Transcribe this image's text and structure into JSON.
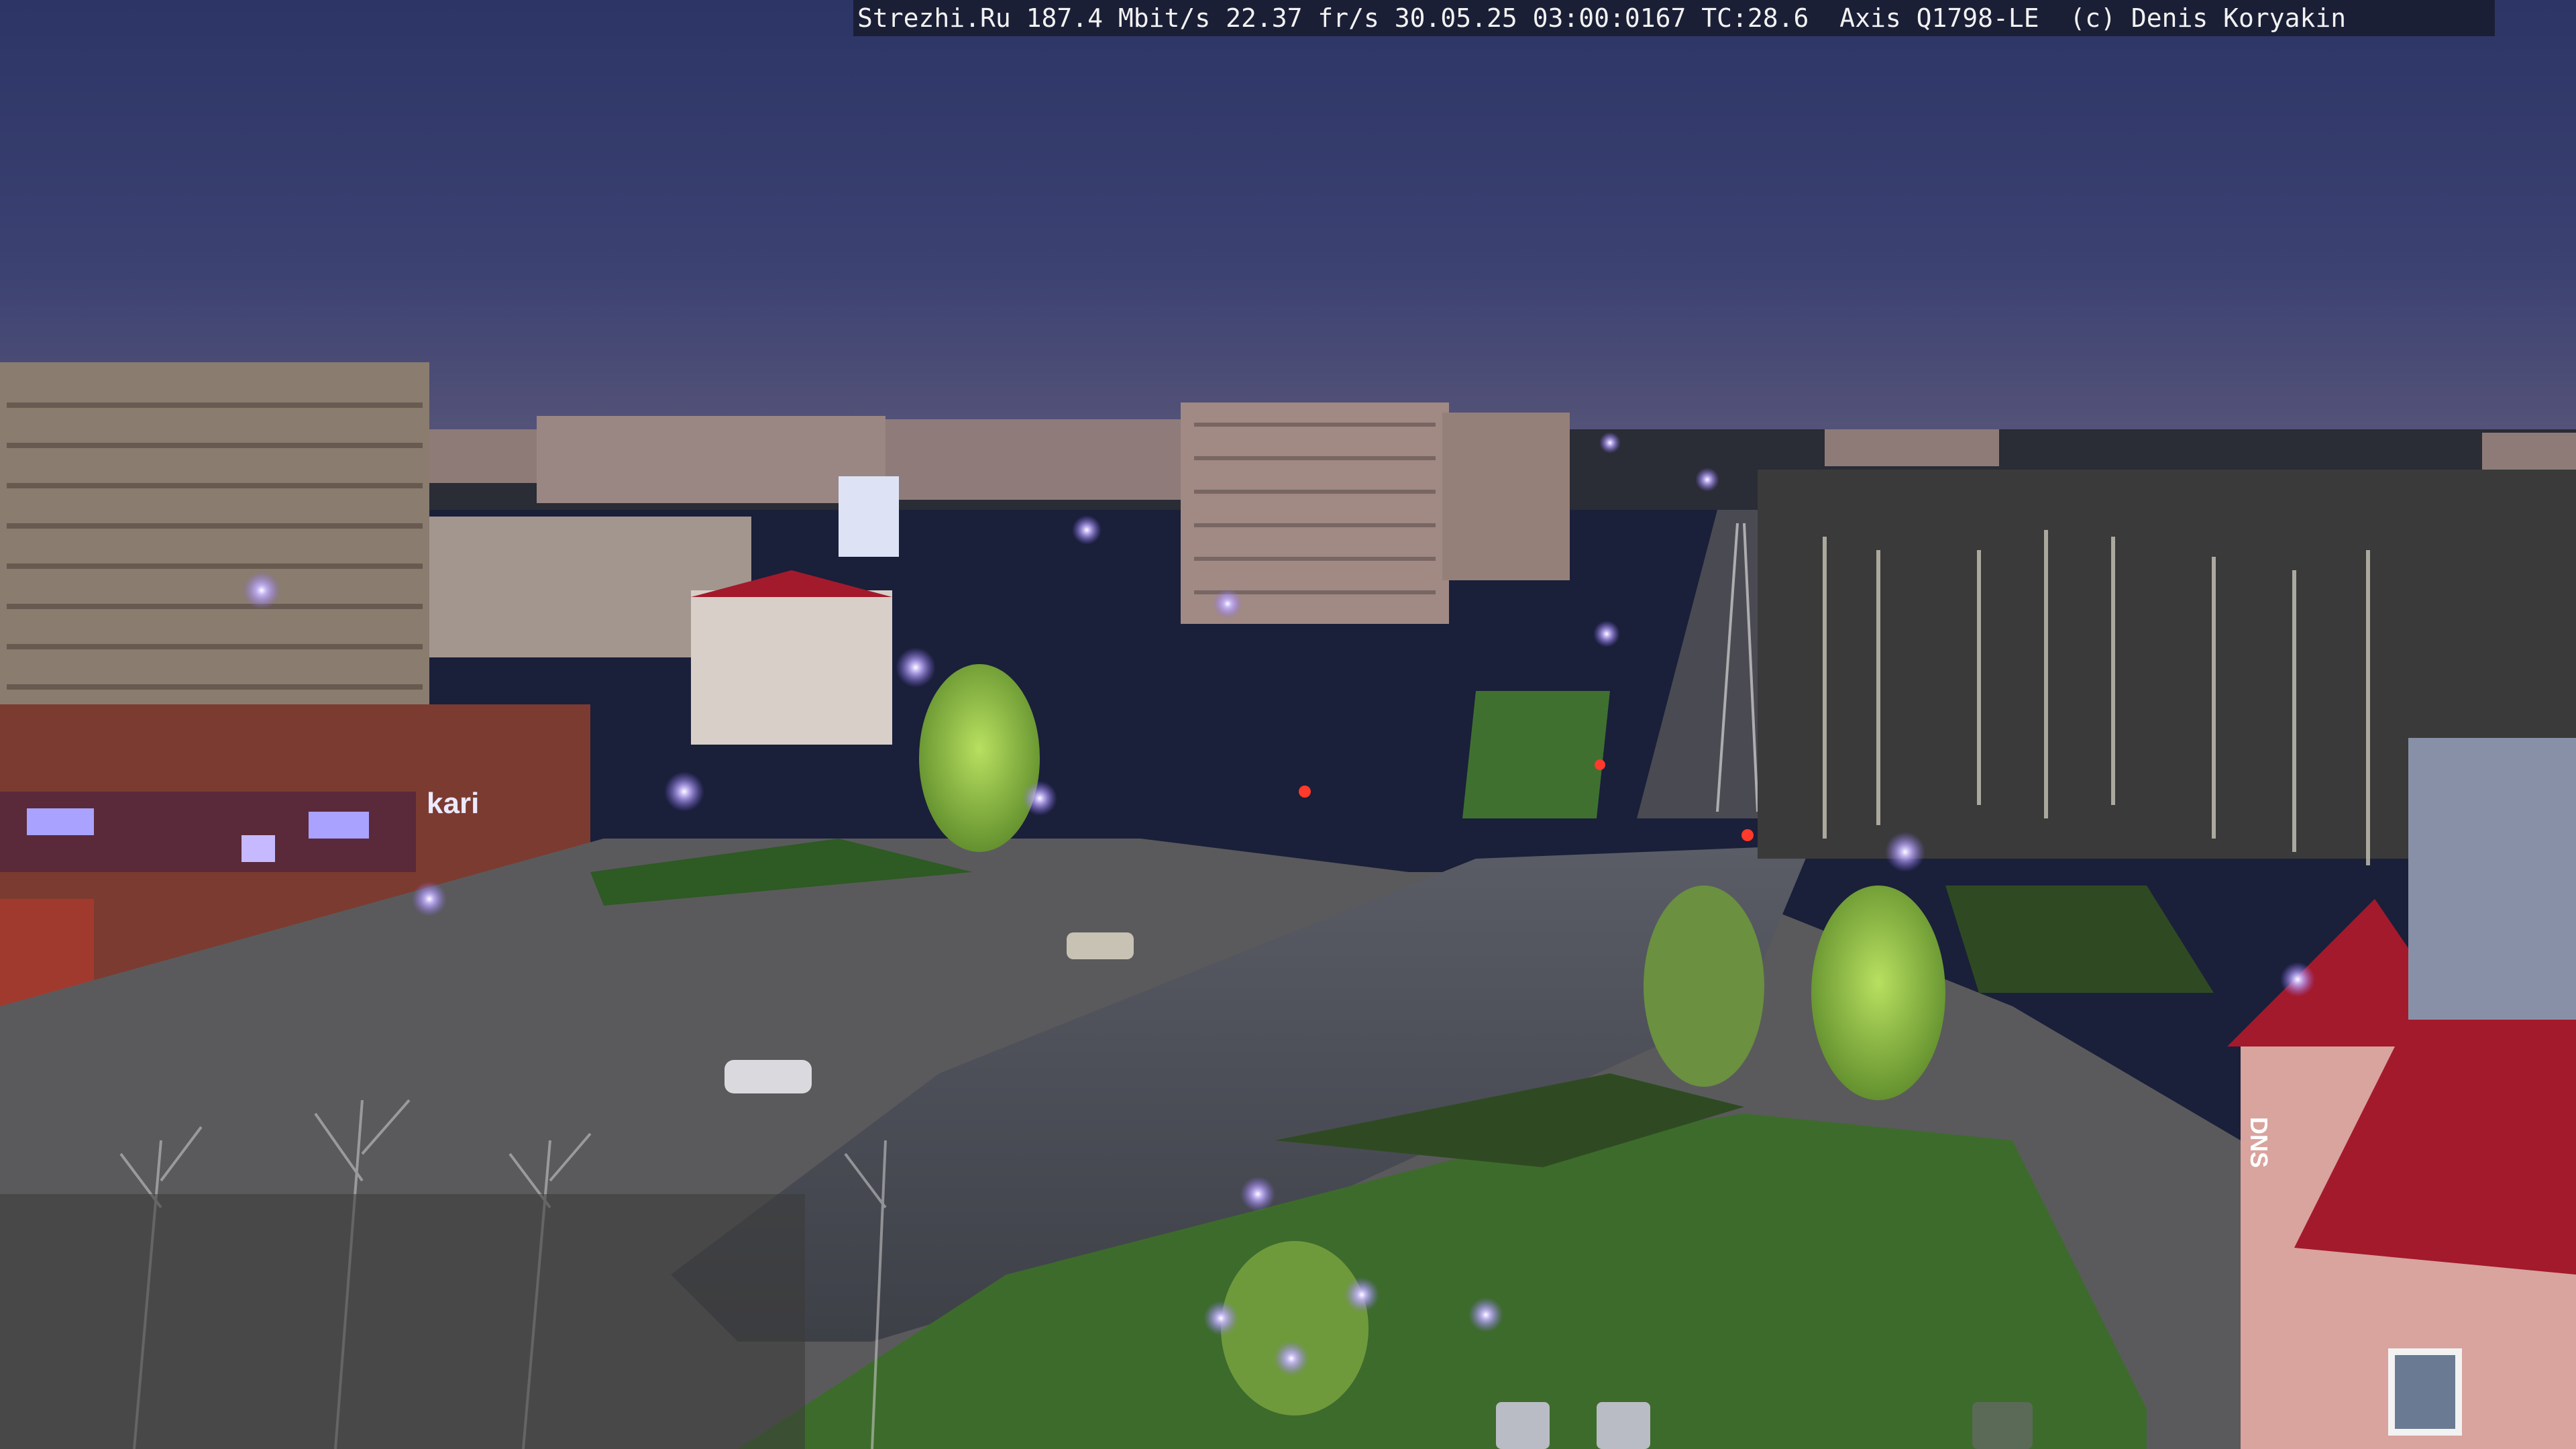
{
  "camera_overlay": {
    "text": "Strezhi.Ru 187.4 Mbit/s 22.37 fr/s 30.05.25 03:00:0167 TC:28.6  Axis Q1798-LE  (c) Denis Koryakin"
  },
  "signage": {
    "store_left": "kari",
    "store_right": "DNS"
  },
  "colors": {
    "sky_top": "#2c3566",
    "sky_horizon": "#4a4e7a",
    "street_light": "#b9a8ff",
    "grass": "#3d6b2c",
    "roof_red": "#a31a2c"
  }
}
